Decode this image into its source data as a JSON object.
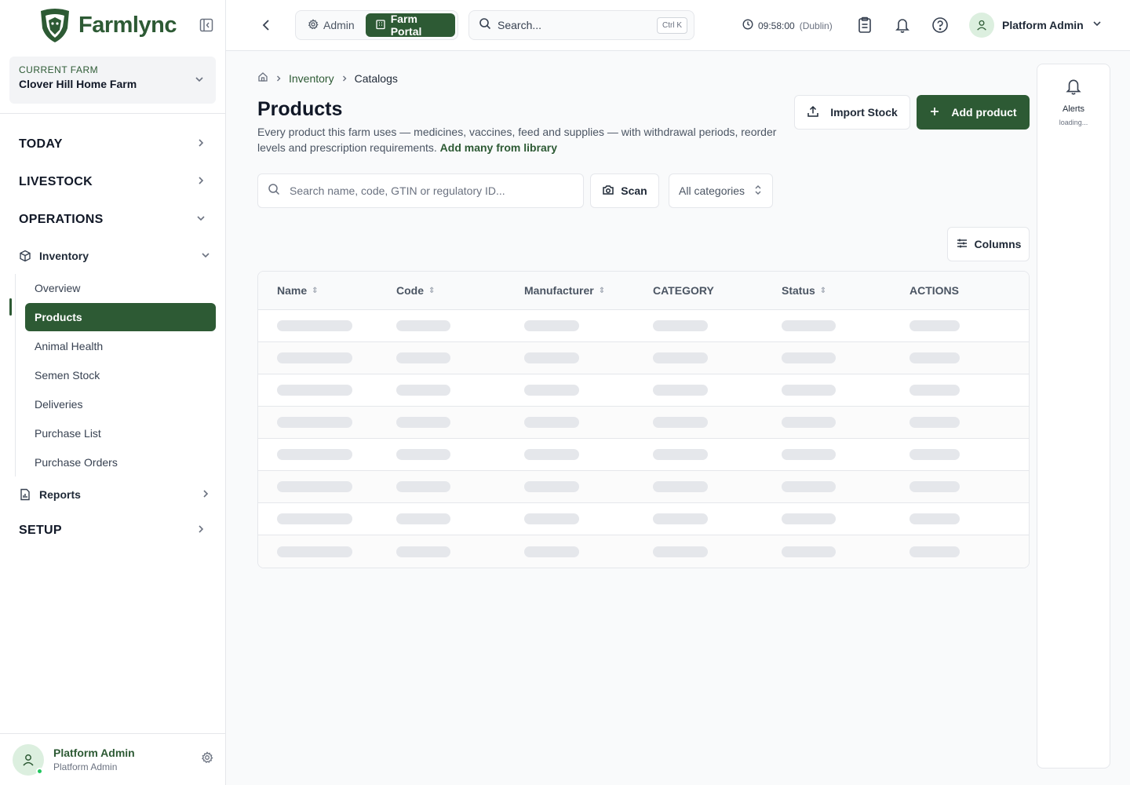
{
  "brand": {
    "name": "Farmlync"
  },
  "farm": {
    "label": "CURRENT FARM",
    "name": "Clover Hill Home Farm"
  },
  "nav": {
    "sections": {
      "today": "TODAY",
      "livestock": "LIVESTOCK",
      "operations": "OPERATIONS",
      "setup": "SETUP"
    },
    "inventory": "Inventory",
    "inventory_items": [
      "Overview",
      "Products",
      "Animal Health",
      "Semen Stock",
      "Deliveries",
      "Purchase List",
      "Purchase Orders"
    ],
    "active_item": "Products",
    "reports": "Reports"
  },
  "footer": {
    "name": "Platform Admin",
    "role": "Platform Admin"
  },
  "topbar": {
    "modes": [
      "Admin",
      "Farm Portal"
    ],
    "active_mode": "Farm Portal",
    "search_placeholder": "Search...",
    "search_shortcut": "Ctrl K",
    "time": "09:58:00",
    "timezone": "(Dublin)",
    "user_name": "Platform Admin"
  },
  "breadcrumb": {
    "level1": "Inventory",
    "level2": "Catalogs"
  },
  "page": {
    "title": "Products",
    "description": "Every product this farm uses — medicines, vaccines, feed and supplies — with withdrawal periods, reorder levels and prescription requirements.",
    "library_link": "Add many from library",
    "import_label": "Import Stock",
    "add_label": "Add product"
  },
  "filters": {
    "search_placeholder": "Search name, code, GTIN or regulatory ID...",
    "scan_label": "Scan",
    "category_value": "All categories",
    "columns_label": "Columns"
  },
  "table": {
    "columns": [
      "Name",
      "Code",
      "Manufacturer",
      "CATEGORY",
      "Status",
      "ACTIONS"
    ],
    "loading_rows": 8
  },
  "alerts": {
    "title": "Alerts",
    "status": "loading..."
  },
  "colors": {
    "brand": "#2d5a34",
    "border": "#e5e7eb",
    "skeleton": "#e5e7eb"
  }
}
